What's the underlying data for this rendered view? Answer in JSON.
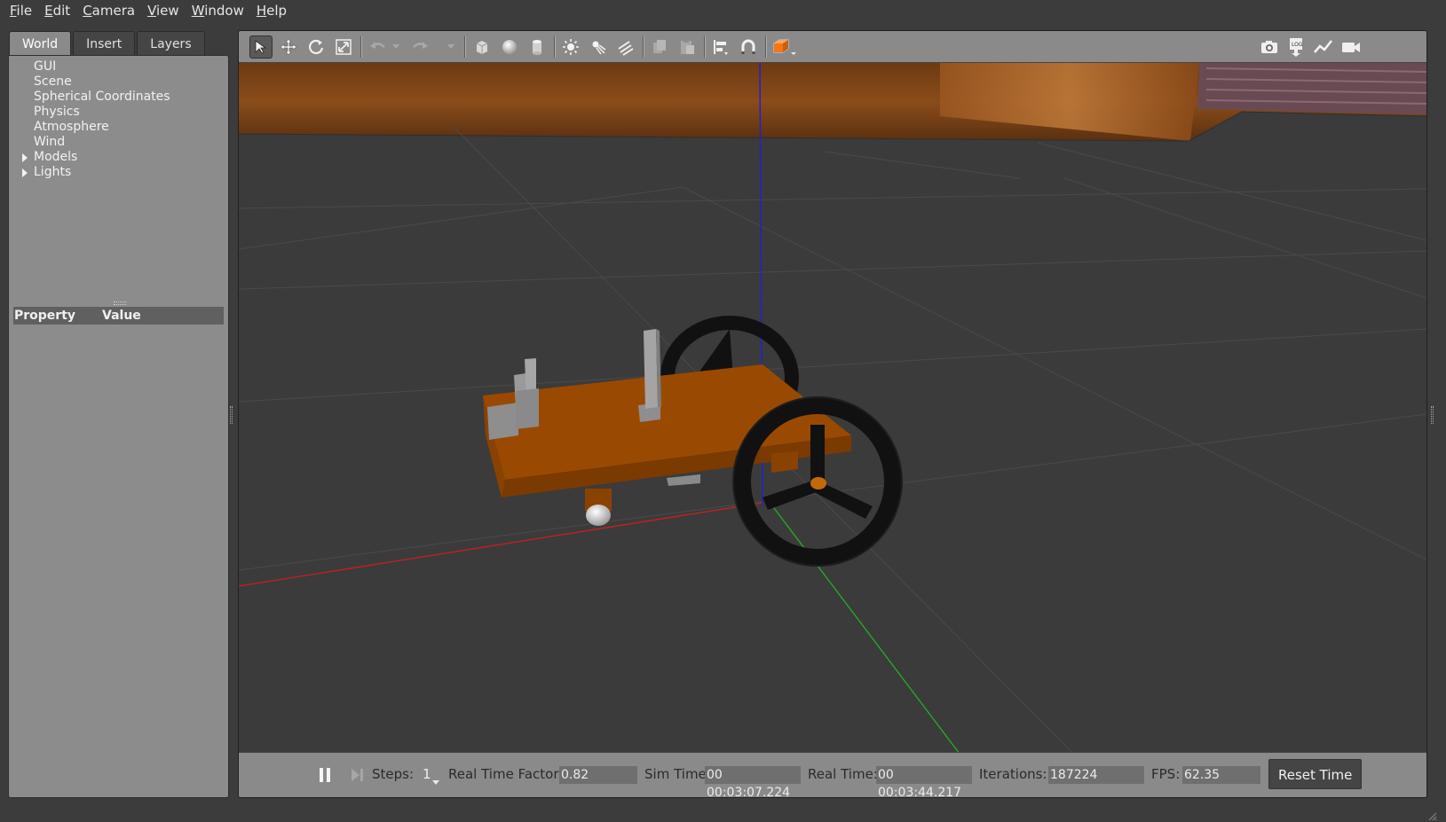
{
  "menu": [
    {
      "accel": "F",
      "rest": "ile"
    },
    {
      "accel": "E",
      "rest": "dit"
    },
    {
      "accel": "C",
      "rest": "amera"
    },
    {
      "accel": "V",
      "rest": "iew"
    },
    {
      "accel": "W",
      "rest": "indow"
    },
    {
      "accel": "H",
      "rest": "elp"
    }
  ],
  "left_tabs": [
    "World",
    "Insert",
    "Layers"
  ],
  "tree": {
    "items": [
      "GUI",
      "Scene",
      "Spherical Coordinates",
      "Physics",
      "Atmosphere",
      "Wind",
      "Models",
      "Lights"
    ]
  },
  "properties": {
    "col_property": "Property",
    "col_value": "Value"
  },
  "toolbar": {
    "icons": [
      "select-arrow-icon",
      "translate-icon",
      "rotate-icon",
      "scale-icon",
      "undo-icon",
      "redo-icon",
      "box-shape-icon",
      "sphere-shape-icon",
      "cylinder-shape-icon",
      "point-light-icon",
      "spot-light-icon",
      "directional-light-icon",
      "copy-icon",
      "paste-icon",
      "align-icon",
      "snap-magnet-icon",
      "view-angle-icon",
      "screenshot-icon",
      "log-icon",
      "plot-icon",
      "record-video-icon"
    ]
  },
  "bottom": {
    "steps_label": "Steps:",
    "steps_value": "1",
    "rtf_label": "Real Time Factor:",
    "rtf_value": "0.82",
    "sim_label": "Sim Time:",
    "sim_value": "00 00:03:07.224",
    "real_label": "Real Time:",
    "real_value": "00 00:03:44.217",
    "iter_label": "Iterations:",
    "iter_value": "187224",
    "fps_label": "FPS:",
    "fps_value": "62.35",
    "reset_label": "Reset Time"
  },
  "colors": {
    "robot_body": "#9a4a00",
    "wheel": "#111111",
    "axis_x": "#c82020",
    "axis_y": "#22b022",
    "axis_z": "#2020d0",
    "view_angle_accent": "#f07818"
  }
}
